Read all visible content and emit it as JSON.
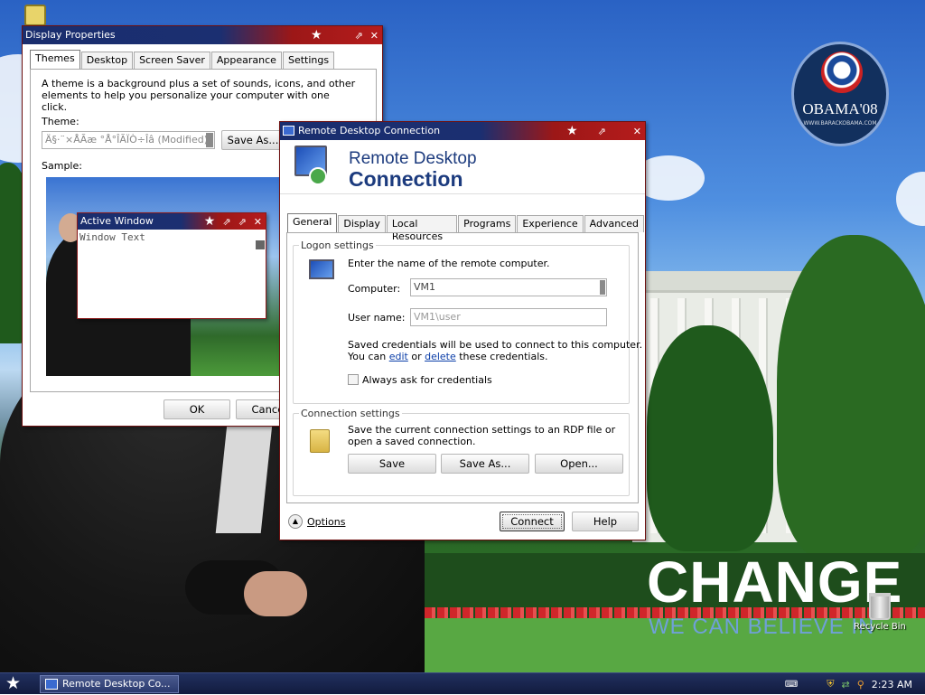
{
  "desktop": {
    "slogan_main": "CHANGE",
    "slogan_sub": "WE CAN BELIEVE IN",
    "logo_text": "OBAMA'08",
    "logo_small": "WWW.BARACKOBAMA.COM",
    "recycle_bin_label": "Recycle Bin"
  },
  "display_properties": {
    "title": "Display Properties",
    "tabs": [
      "Themes",
      "Desktop",
      "Screen Saver",
      "Appearance",
      "Settings"
    ],
    "description": "A theme is a background plus a set of sounds, icons, and other elements to help you personalize your computer with one click.",
    "theme_label": "Theme:",
    "theme_value": "Ä§·¨×ÅÃæ °Å°ÎÃÏÒ÷Îâ (Modified)",
    "save_as_label": "Save As...",
    "sample_label": "Sample:",
    "ok_label": "OK",
    "cancel_label": "Cancel",
    "active_window": {
      "title": "Active Window",
      "text": "Window Text"
    }
  },
  "rdc": {
    "title": "Remote Desktop Connection",
    "header_line1": "Remote Desktop",
    "header_line2": "Connection",
    "tabs": [
      "General",
      "Display",
      "Local Resources",
      "Programs",
      "Experience",
      "Advanced"
    ],
    "logon_settings_legend": "Logon settings",
    "logon_prompt": "Enter the name of the remote computer.",
    "computer_label": "Computer:",
    "computer_value": "VM1",
    "username_label": "User name:",
    "username_value": "VM1\\user",
    "creds_line1": "Saved credentials will be used to connect to this computer.",
    "creds_pre": "You can ",
    "creds_edit": "edit",
    "creds_or": " or ",
    "creds_delete": "delete",
    "creds_post": " these credentials.",
    "always_ask_label": "Always ask for credentials",
    "connection_settings_legend": "Connection settings",
    "conn_desc": "Save the current connection settings to an RDP file or open a saved connection.",
    "save_label": "Save",
    "save_as_label": "Save As...",
    "open_label": "Open...",
    "options_label": "Options",
    "connect_label": "Connect",
    "help_label": "Help"
  },
  "taskbar": {
    "task_label": "Remote Desktop Co...",
    "clock": "2:23 AM"
  }
}
